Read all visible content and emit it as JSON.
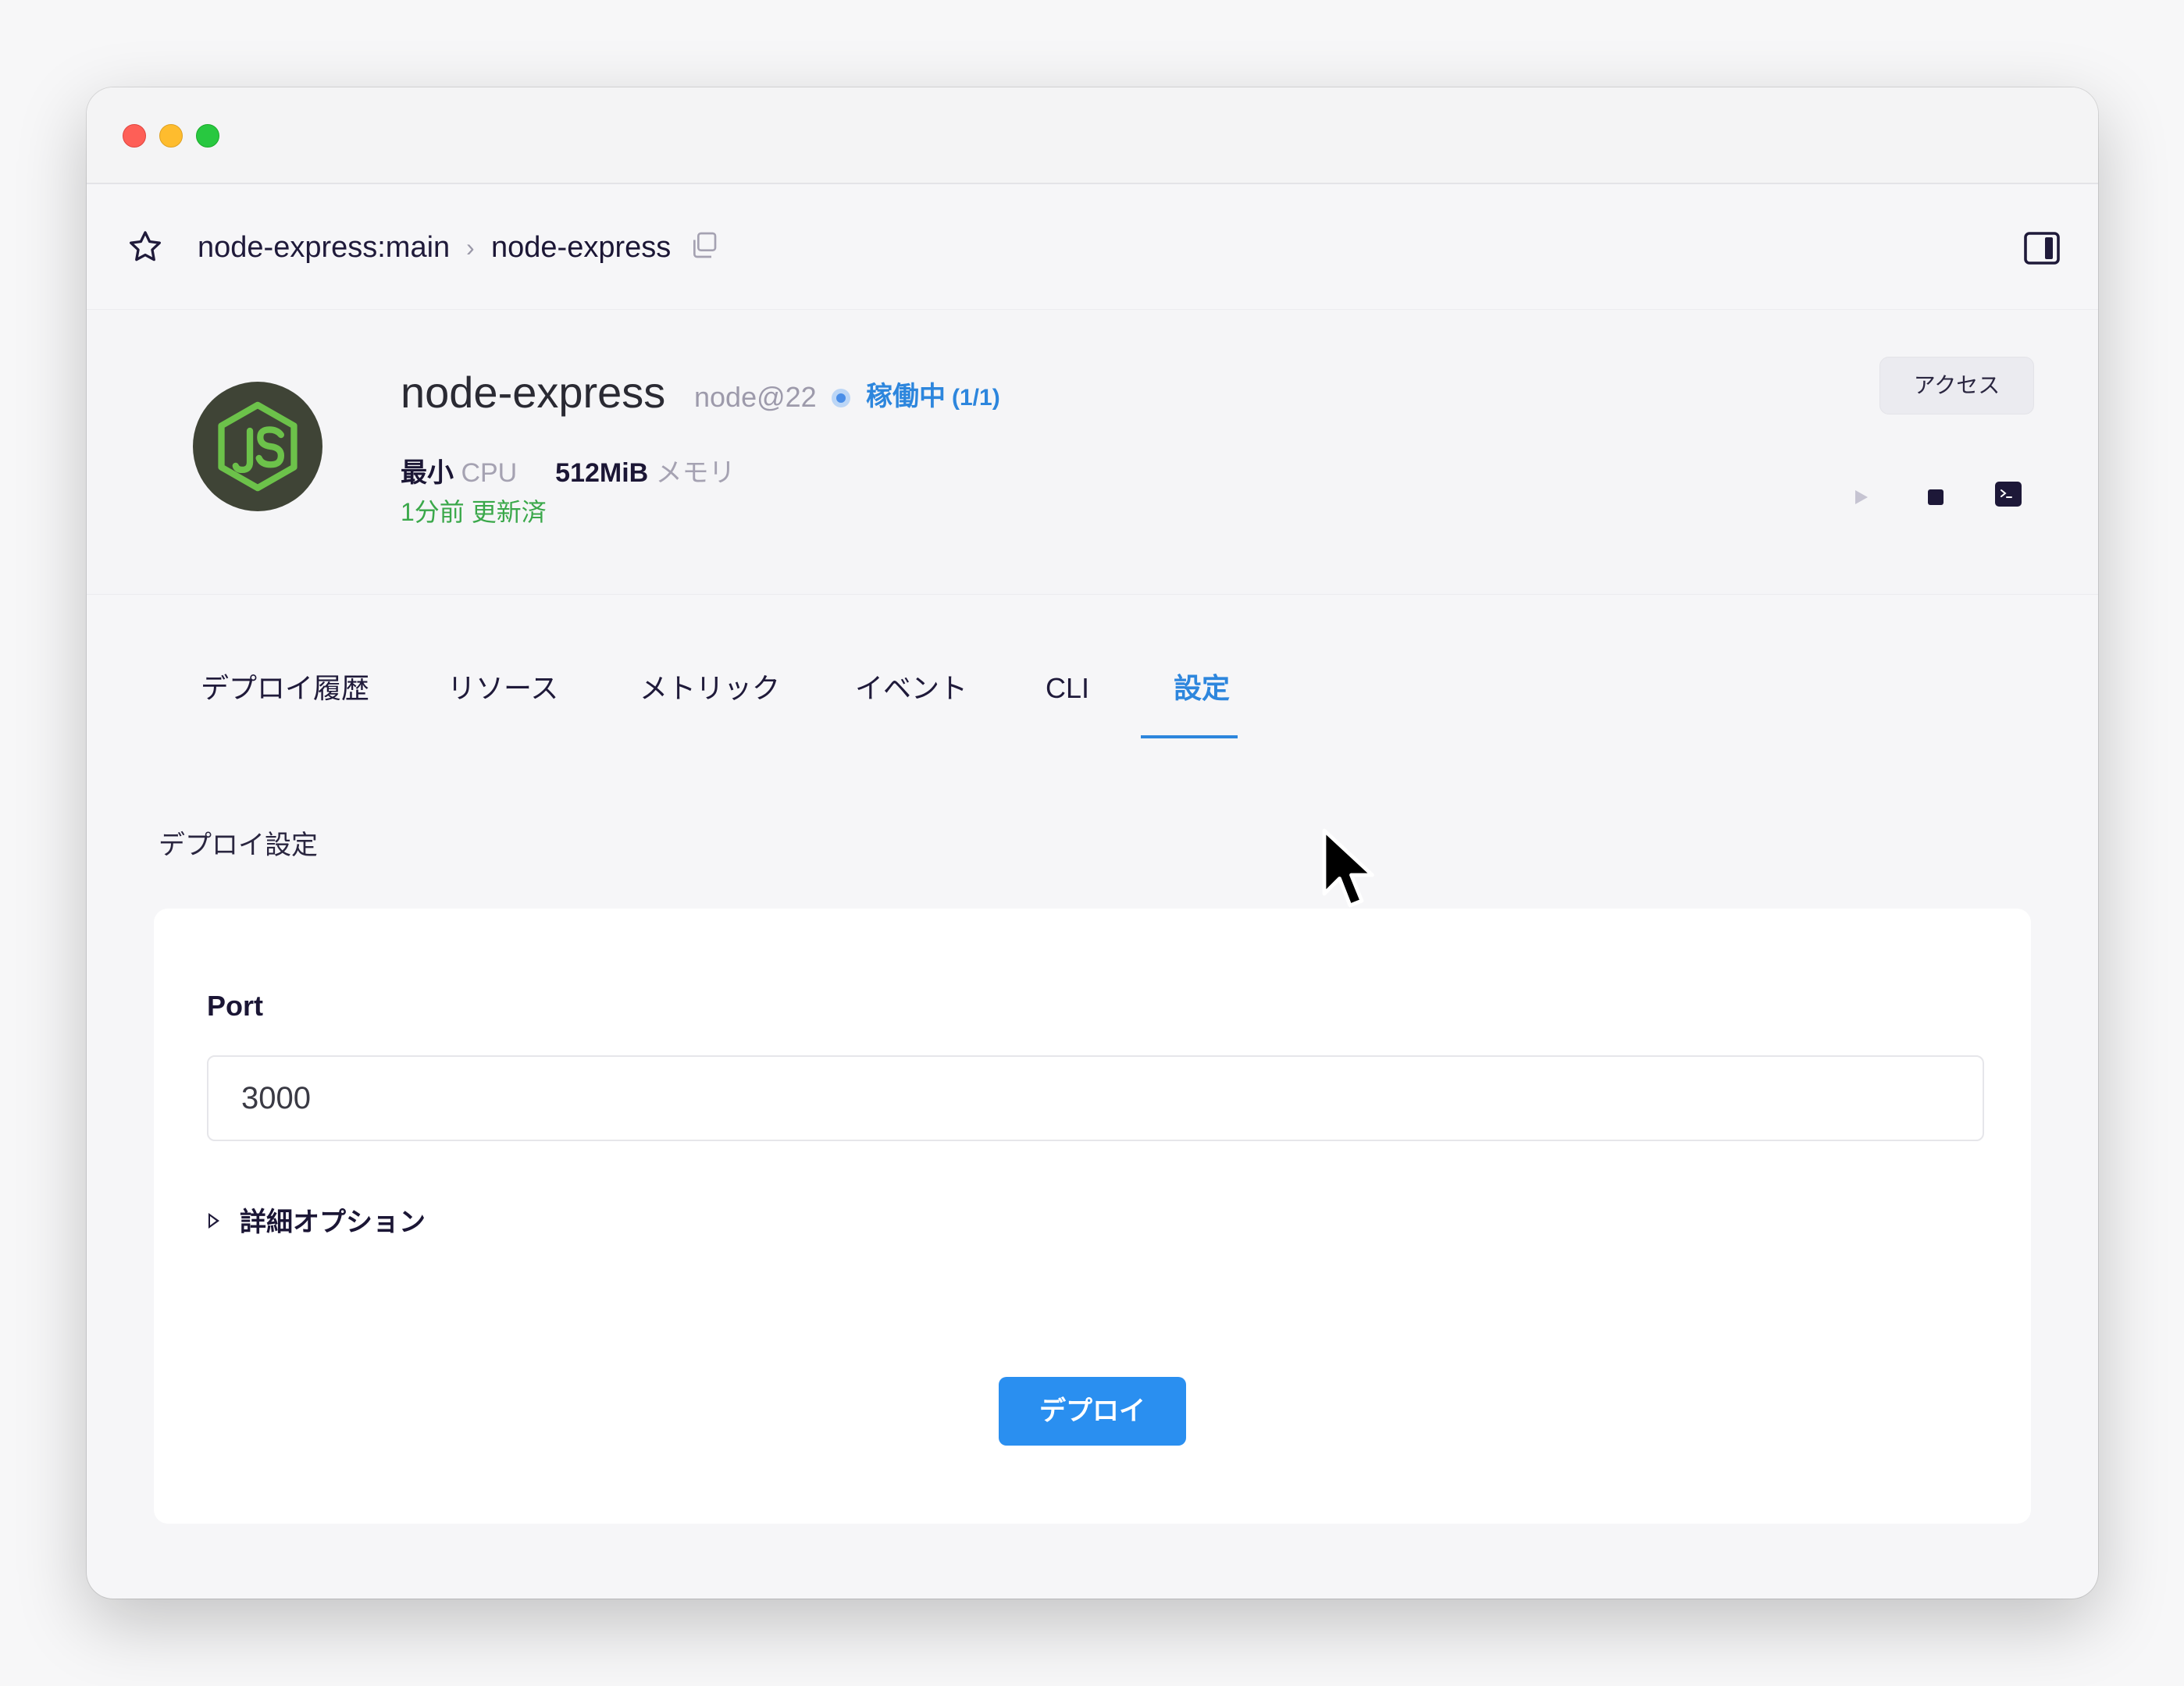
{
  "breadcrumb": {
    "project": "node-express:main",
    "separator": "›",
    "service": "node-express"
  },
  "service": {
    "name": "node-express",
    "runtime": "node@22",
    "status": "稼働中",
    "replicas": "(1/1)",
    "cpu_value": "最小",
    "cpu_label": "CPU",
    "memory_value": "512MiB",
    "memory_label": "メモリ",
    "updated": "1分前 更新済",
    "access_label": "アクセス"
  },
  "tabs": [
    {
      "label": "デプロイ履歴",
      "active": false
    },
    {
      "label": "リソース",
      "active": false
    },
    {
      "label": "メトリック",
      "active": false
    },
    {
      "label": "イベント",
      "active": false
    },
    {
      "label": "CLI",
      "active": false
    },
    {
      "label": "設定",
      "active": true
    }
  ],
  "settings": {
    "section_title": "デプロイ設定",
    "port_label": "Port",
    "port_value": "3000",
    "advanced_label": "詳細オプション",
    "deploy_label": "デプロイ"
  },
  "colors": {
    "accent": "#2d86dd",
    "button": "#2a8ff0",
    "updated": "#3aa84a",
    "logo_bg": "#3f4436",
    "logo_fg": "#6cc24a"
  }
}
